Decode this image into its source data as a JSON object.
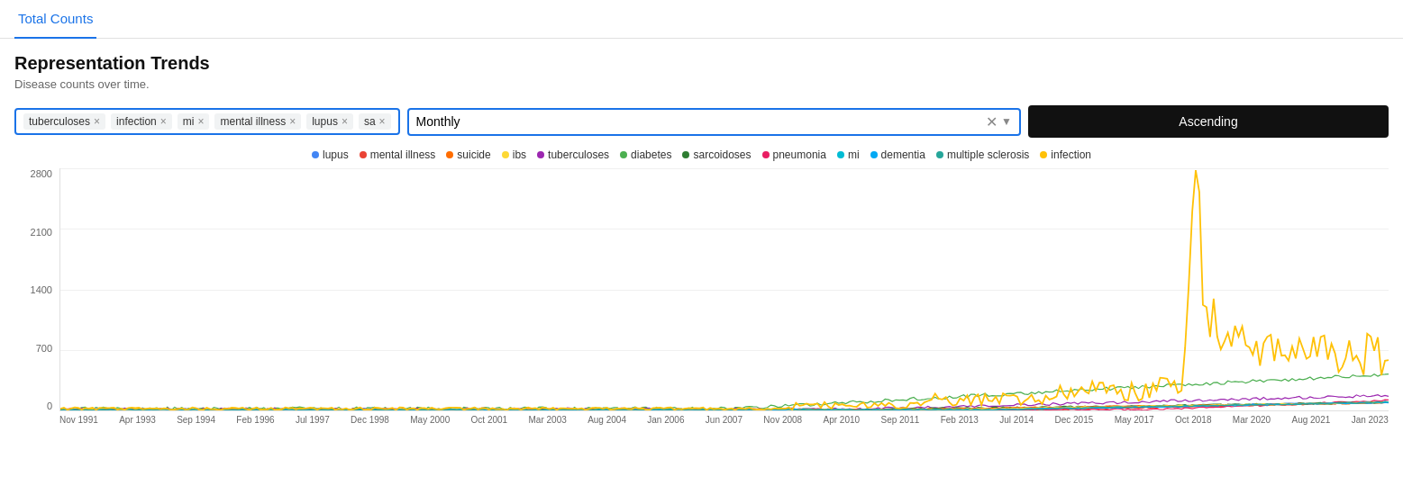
{
  "tab": "Total Counts",
  "title": "Representation Trends",
  "subtitle": "Disease counts over time.",
  "tags": [
    {
      "label": "tuberculoses",
      "id": "tuberculoses"
    },
    {
      "label": "infection",
      "id": "infection"
    },
    {
      "label": "mi",
      "id": "mi"
    },
    {
      "label": "mental illness",
      "id": "mental_illness"
    },
    {
      "label": "lupus",
      "id": "lupus"
    },
    {
      "label": "sa",
      "id": "sa"
    }
  ],
  "search_value": "Monthly",
  "search_placeholder": "Monthly",
  "ascending_label": "Ascending",
  "legend": [
    {
      "label": "lupus",
      "color": "#4285F4"
    },
    {
      "label": "mental illness",
      "color": "#EA4335"
    },
    {
      "label": "suicide",
      "color": "#FF6D00"
    },
    {
      "label": "ibs",
      "color": "#FDD835"
    },
    {
      "label": "tuberculoses",
      "color": "#9C27B0"
    },
    {
      "label": "diabetes",
      "color": "#4CAF50"
    },
    {
      "label": "sarcoidoses",
      "color": "#2E7D32"
    },
    {
      "label": "pneumonia",
      "color": "#E91E63"
    },
    {
      "label": "mi",
      "color": "#00BCD4"
    },
    {
      "label": "dementia",
      "color": "#03A9F4"
    },
    {
      "label": "multiple sclerosis",
      "color": "#26A69A"
    },
    {
      "label": "infection",
      "color": "#FFC107"
    }
  ],
  "y_labels": [
    "2800",
    "2100",
    "1400",
    "700",
    "0"
  ],
  "x_labels": [
    "Nov 1991",
    "Apr 1993",
    "Sep 1994",
    "Feb 1996",
    "Jul 1997",
    "Dec 1998",
    "May 2000",
    "Oct 2001",
    "Mar 2003",
    "Aug 2004",
    "Jan 2006",
    "Jun 2007",
    "Nov 2008",
    "Apr 2010",
    "Sep 2011",
    "Feb 2013",
    "Jul 2014",
    "Dec 2015",
    "May 2017",
    "Oct 2018",
    "Mar 2020",
    "Aug 2021",
    "Jan 2023"
  ]
}
